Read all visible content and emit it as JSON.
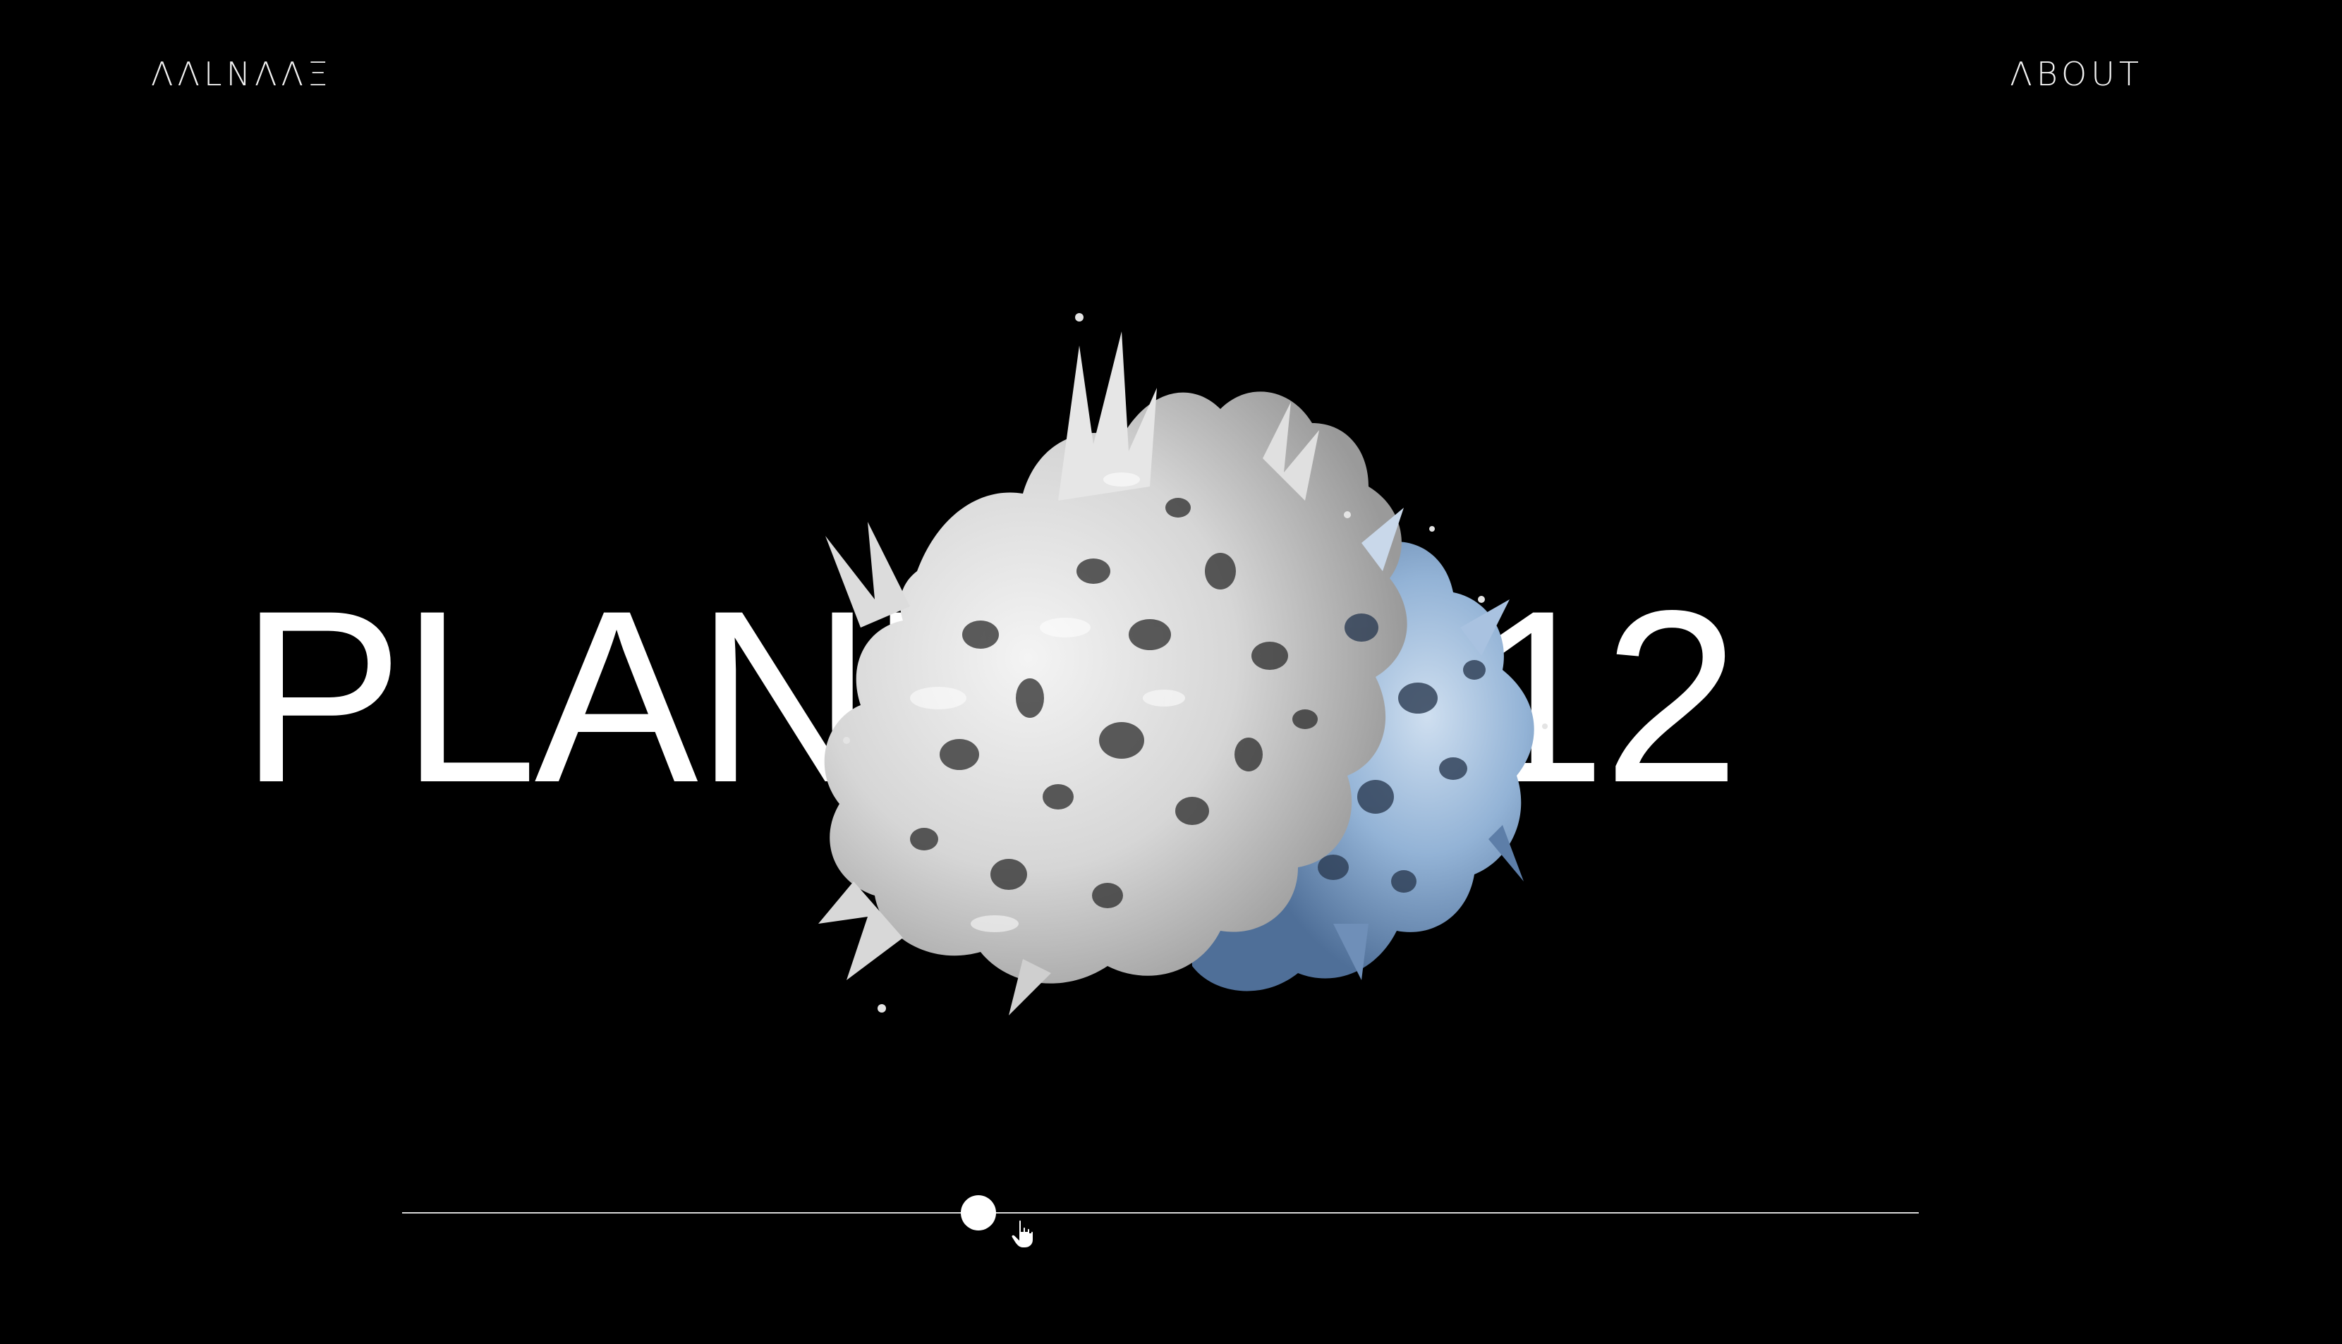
{
  "header": {
    "logo_text": "ΛΛLNΛΛΞ",
    "about_label": "ΛBOUT"
  },
  "hero": {
    "title": "PLANETS: 12",
    "object_icon": "foam-splash-sculpture-icon"
  },
  "slider": {
    "value_fraction": 0.38,
    "icon": "hand-pointer-cursor-icon"
  },
  "colors": {
    "background": "#000000",
    "text": "#ffffff",
    "track": "#d8d8d8",
    "sculpture_light": "#e8e8e8",
    "sculpture_blue": "#7a9cc4"
  }
}
